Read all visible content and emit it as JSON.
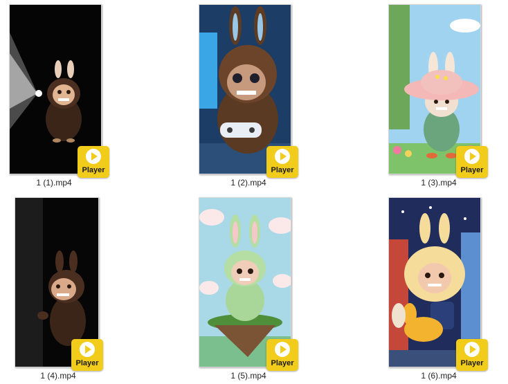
{
  "files": [
    {
      "name": "1 (1).mp4",
      "badge": "Player"
    },
    {
      "name": "1 (2).mp4",
      "badge": "Player"
    },
    {
      "name": "1 (3).mp4",
      "badge": "Player"
    },
    {
      "name": "1 (4).mp4",
      "badge": "Player"
    },
    {
      "name": "1 (5).mp4",
      "badge": "Player"
    },
    {
      "name": "1 (6).mp4",
      "badge": "Player"
    }
  ],
  "colors": {
    "badge": "#f2cc1a",
    "background": "#ffffff"
  },
  "icons": {
    "badge_icon": "play-circle-icon"
  }
}
